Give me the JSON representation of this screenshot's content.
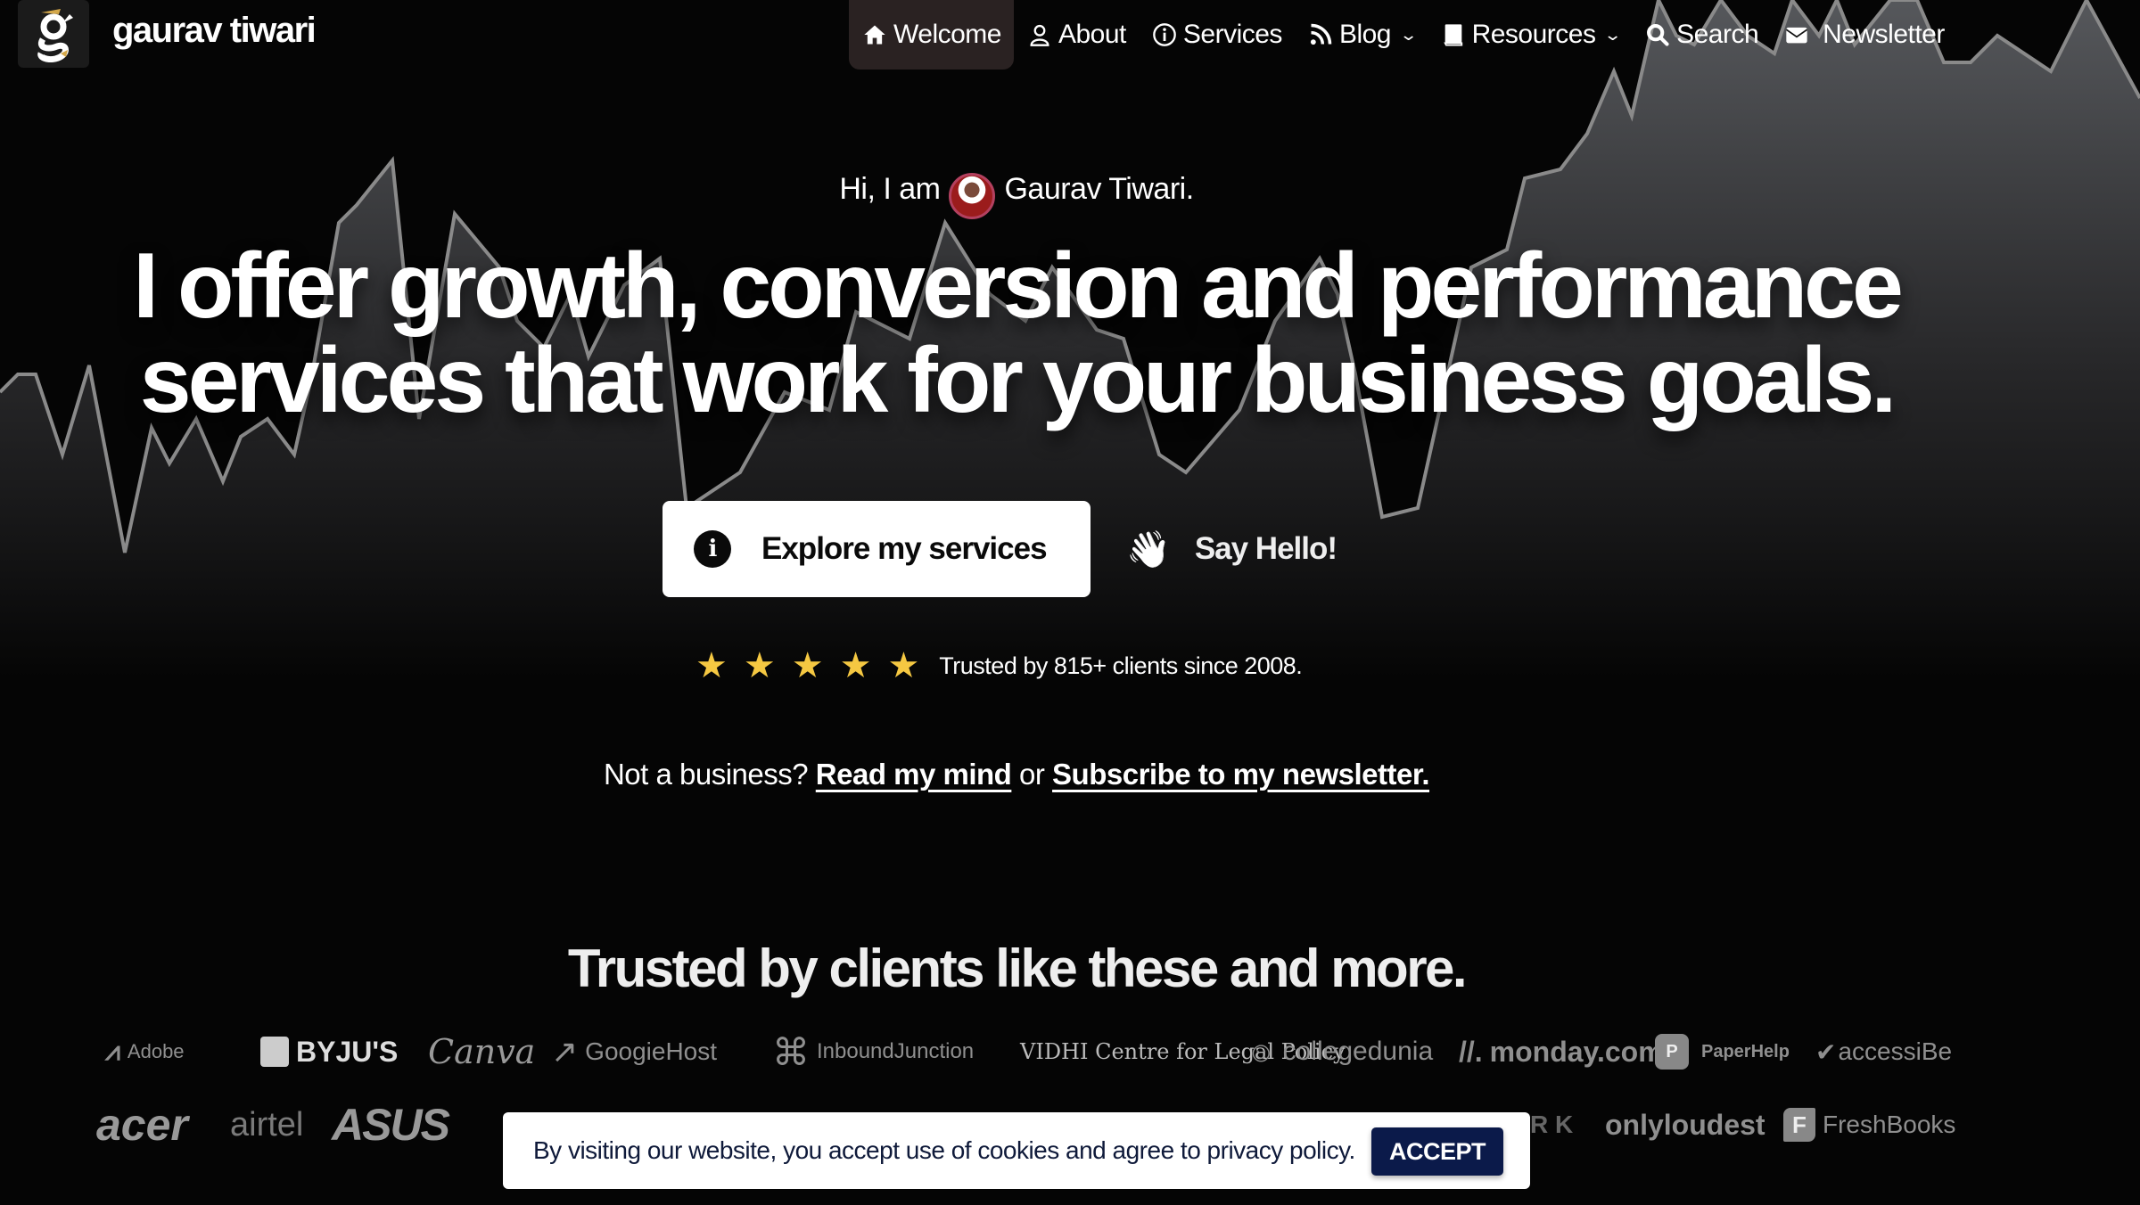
{
  "header": {
    "brand": "gaurav tiwari",
    "nav": [
      {
        "label": "Welcome",
        "icon": "home-icon",
        "active": true
      },
      {
        "label": "About",
        "icon": "user-icon"
      },
      {
        "label": "Services",
        "icon": "info-circle-icon"
      },
      {
        "label": "Blog",
        "icon": "rss-icon",
        "dropdown": true
      },
      {
        "label": "Resources",
        "icon": "book-icon",
        "dropdown": true
      },
      {
        "label": "Search",
        "icon": "search-icon"
      },
      {
        "label": "Newsletter",
        "icon": "envelope-icon"
      }
    ]
  },
  "hero": {
    "intro_prefix": "Hi, I am",
    "intro_name": "Gaurav Tiwari.",
    "headline_line1": "I offer growth, conversion and performance",
    "headline_line2": "services that work for your business goals.",
    "primary_cta": "Explore my services",
    "secondary_cta": "Say Hello!",
    "rating_stars": 5,
    "rating_max": 5,
    "rating_text": "Trusted by 815+ clients since 2008.",
    "not_business_prefix": "Not a business?",
    "link_read_mind": "Read my mind",
    "link_or": "or",
    "link_subscribe": "Subscribe to my newsletter."
  },
  "clients": {
    "heading": "Trusted by clients like these and more.",
    "row1": [
      "Adobe",
      "BYJU'S",
      "Canva",
      "GoogieHost",
      "InboundJunction",
      "VIDHI Centre for Legal Policy",
      "collegedunia",
      "monday.com",
      "PaperHelp",
      "accessiBe"
    ],
    "row2": [
      "acer",
      "airtel",
      "ASUS",
      "onlyloudest",
      "FreshBooks"
    ]
  },
  "cookie_banner": {
    "text": "By visiting our website, you accept use of cookies and agree to privacy policy.",
    "accept_label": "ACCEPT"
  },
  "colors": {
    "star": "#f5c842",
    "accept_bg": "#0b1a4a",
    "active_nav_bg": "#2a2222"
  }
}
